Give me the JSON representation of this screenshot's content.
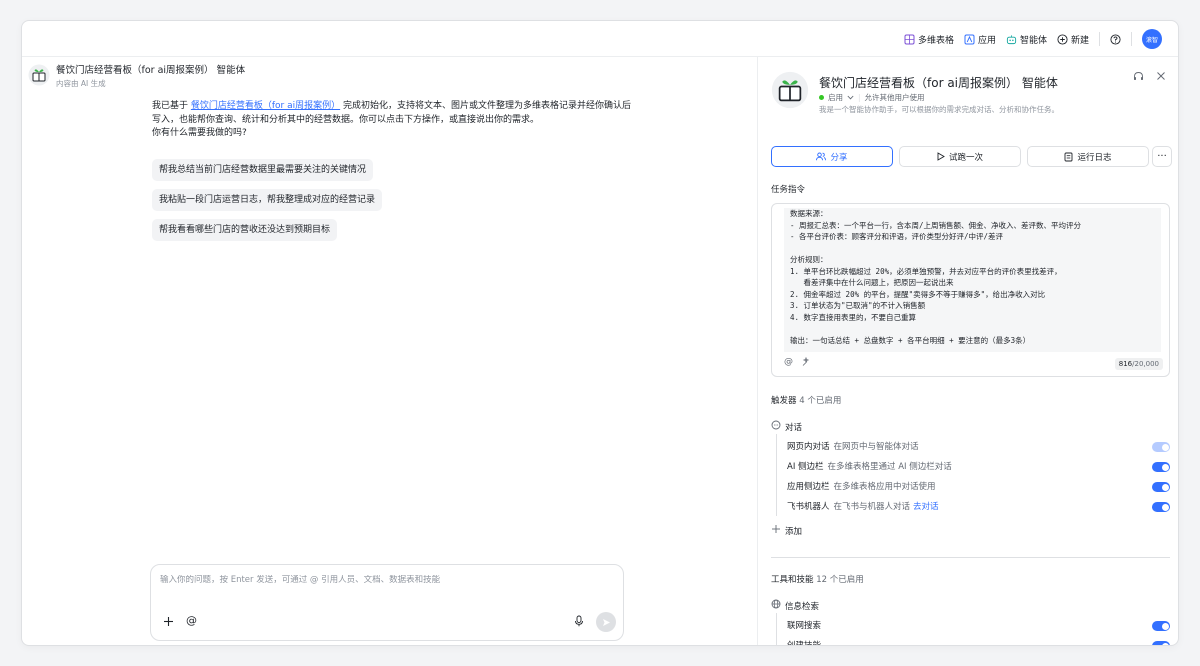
{
  "topnav": {
    "items": [
      "多维表格",
      "应用",
      "智能体",
      "新建"
    ],
    "avatar_text": "滚智"
  },
  "chat": {
    "agent_name": "餐饮门店经营看板（for ai周报案例） 智能体",
    "ai_note": "内容由 AI 生成",
    "msg_prefix": "我已基于 ",
    "msg_link": "餐饮门店经营看板（for ai周报案例）",
    "msg_rest": " 完成初始化，支持将文本、图片或文件整理为多维表格记录并经你确认后写入，也能帮你查询、统计和分析其中的经营数据。你可以点击下方操作，或直接说出你的需求。",
    "msg_question": "你有什么需要我做的吗?",
    "suggestions": [
      "帮我总结当前门店经营数据里最需要关注的关键情况",
      "我粘贴一段门店运营日志，帮我整理成对应的经营记录",
      "帮我看看哪些门店的营收还没达到预期目标"
    ],
    "input_placeholder": "输入你的问题，按 Enter 发送，可通过 @ 引用人员、文档、数据表和技能"
  },
  "panel": {
    "title": "餐饮门店经营看板（for ai周报案例） 智能体",
    "status": "启用",
    "permission": "允许其他用户使用",
    "description": "我是一个智能协作助手，可以根据你的需求完成对话、分析和协作任务。",
    "buttons": [
      "分享",
      "试跑一次",
      "运行日志"
    ],
    "task_label": "任务指令",
    "prompt_lines": [
      "数据来源：",
      "- 周报汇总表：一个平台一行，含本周/上周销售额、佣金、净收入、差评数、平均评分",
      "- 各平台评价表：顾客评分和评语，评价类型分好评/中评/差评",
      "",
      "分析规则：",
      "1. 单平台环比跌幅超过 20%，必须单独预警，并去对应平台的评价表里找差评，",
      "   看差评集中在什么问题上，把原因一起说出来",
      "2. 佣金率超过 20% 的平台，提醒\"卖得多不等于赚得多\"，给出净收入对比",
      "3. 订单状态为\"已取消\"的不计入销售额",
      "4. 数字直接用表里的，不要自己重算",
      "",
      "输出：一句话总结 + 总盘数字 + 各平台明细 + 要注意的（最多3条）"
    ],
    "counter_current": "816",
    "counter_total": "/20,000",
    "trigger_label": "触发器",
    "trigger_count": "4 个已启用",
    "dialog_head": "对话",
    "triggers": [
      {
        "name": "网页内对话",
        "desc": "在网页中与智能体对话",
        "link": "",
        "on": true,
        "dim": true
      },
      {
        "name": "AI 侧边栏",
        "desc": "在多维表格里通过 AI 侧边栏对话",
        "link": "",
        "on": true,
        "dim": false
      },
      {
        "name": "应用侧边栏",
        "desc": "在多维表格应用中对话使用",
        "link": "",
        "on": true,
        "dim": false
      },
      {
        "name": "飞书机器人",
        "desc": "在飞书与机器人对话",
        "link": "去对话",
        "on": true,
        "dim": false
      }
    ],
    "add_label": "添加",
    "tools_label": "工具和技能",
    "tools_count": "12 个已启用",
    "info_head": "信息检索",
    "tools": [
      {
        "name": "联网搜索",
        "on": true
      },
      {
        "name": "创建技能",
        "on": true
      }
    ]
  },
  "colors": {
    "accent": "#3370ff",
    "enabled_dot": "#34c724",
    "toggle_dim": "#b5cbff"
  }
}
